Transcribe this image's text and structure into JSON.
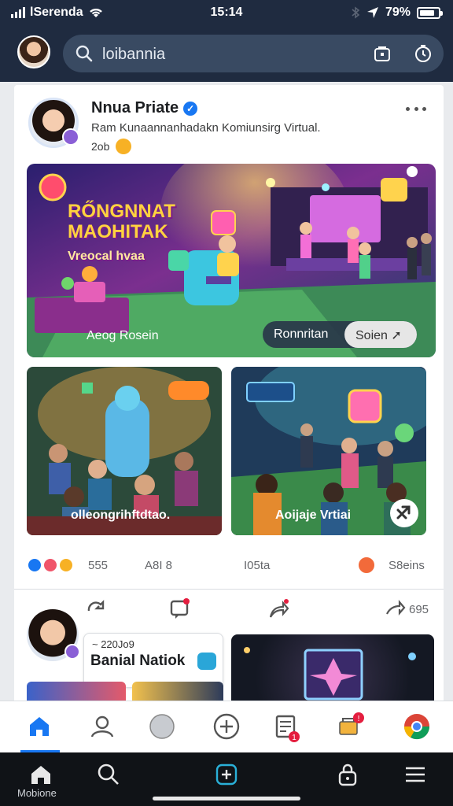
{
  "status_bar": {
    "carrier": "lSerenda",
    "time": "15:14",
    "battery": "79%"
  },
  "search": {
    "text": "loibannia"
  },
  "post": {
    "author": "Nnua Priate",
    "subtitle": "Ram Kunaannanhadakn Komiunsirg Virtual.",
    "time": "2ob",
    "hero": {
      "title_line1": "RŐNGNNAT",
      "title_line2": "MAOHITAK",
      "title_sub": "Vreocal hvaa",
      "caption": "Aeog Rosein",
      "pill_left": "Ronnritan",
      "pill_right": "Soien"
    },
    "thumbs": [
      {
        "caption": "olleongrihftdtao."
      },
      {
        "caption": "Aoijaje Vrtiai"
      }
    ],
    "reactions": {
      "count_left": "555",
      "count_mid": "A8I 8",
      "count_mid2": "I05ta",
      "count_right": "S8eins"
    },
    "actions": {
      "share_count": "695"
    }
  },
  "second_post": {
    "date": "~ 220Jo9",
    "name": "Banial Natiok"
  },
  "system_nav": {
    "home_label": "Mobione"
  },
  "colors": {
    "header_bg": "#1f2b40",
    "accent": "#1877f2",
    "notification": "#e41e3f"
  },
  "icons": {
    "header": [
      "search-icon",
      "bag-icon",
      "timer-icon"
    ],
    "app_nav": [
      "home-icon",
      "profile-icon",
      "heart-icon",
      "plus-icon",
      "news-icon",
      "cart-icon",
      "chrome-icon"
    ],
    "system_nav": [
      "home-icon",
      "search-icon",
      "add-icon",
      "lock-icon",
      "menu-icon"
    ]
  }
}
